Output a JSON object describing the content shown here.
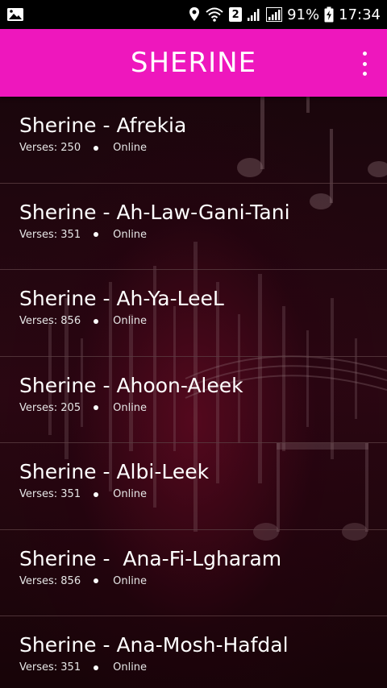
{
  "status_bar": {
    "notification_badge": "2",
    "battery_percent": "91%",
    "time": "17:34"
  },
  "app_bar": {
    "title": "SHERINE"
  },
  "songs": [
    {
      "title": "Sherine - Afrekia",
      "verses_label": "Verses: 250",
      "status": "Online"
    },
    {
      "title": "Sherine - Ah-Law-Gani-Tani",
      "verses_label": "Verses: 351",
      "status": "Online"
    },
    {
      "title": "Sherine - Ah-Ya-LeeL",
      "verses_label": "Verses: 856",
      "status": "Online"
    },
    {
      "title": "Sherine - Ahoon-Aleek",
      "verses_label": "Verses: 205",
      "status": "Online"
    },
    {
      "title": "Sherine - Albi-Leek",
      "verses_label": "Verses: 351",
      "status": "Online"
    },
    {
      "title": "Sherine -  Ana-Fi-Lgharam",
      "verses_label": "Verses: 856",
      "status": "Online"
    },
    {
      "title": "Sherine - Ana-Mosh-Hafdal",
      "verses_label": "Verses: 351",
      "status": "Online"
    }
  ],
  "colors": {
    "app_bar": "#ee17bd",
    "background": "#1a060c"
  }
}
